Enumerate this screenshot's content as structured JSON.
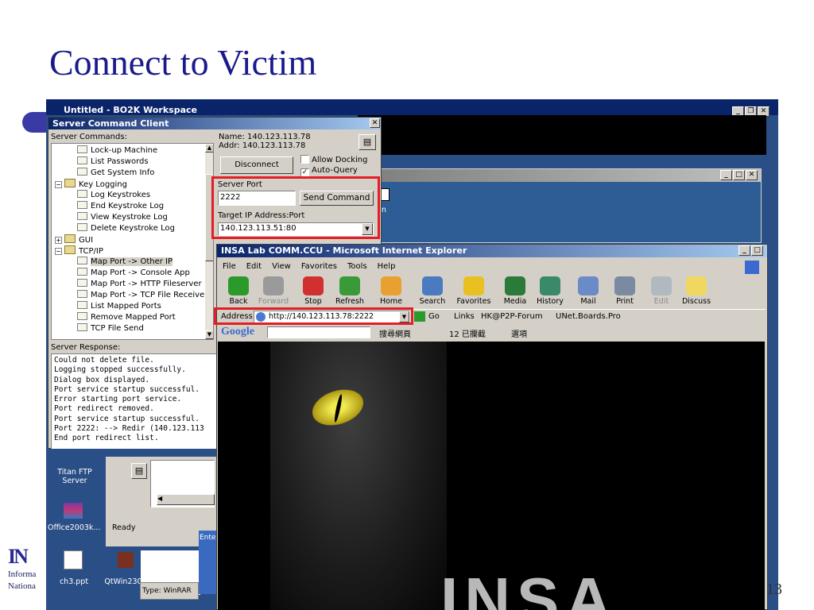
{
  "slide": {
    "title": "Connect to Victim",
    "page_number": "13"
  },
  "logo": {
    "line1": "Informa",
    "line2": "Nationa"
  },
  "bo2k": {
    "title": "Untitled - BO2K Workspace"
  },
  "server_client": {
    "title": "Server Command Client",
    "commands_label": "Server Commands:",
    "tree": [
      {
        "label": "Lock-up Machine",
        "level": 2
      },
      {
        "label": "List Passwords",
        "level": 2
      },
      {
        "label": "Get System Info",
        "level": 2
      },
      {
        "label": "Key Logging",
        "level": 1,
        "expander": "-"
      },
      {
        "label": "Log Keystrokes",
        "level": 2
      },
      {
        "label": "End Keystroke Log",
        "level": 2
      },
      {
        "label": "View Keystroke Log",
        "level": 2
      },
      {
        "label": "Delete Keystroke Log",
        "level": 2
      },
      {
        "label": "GUI",
        "level": 1,
        "expander": "+"
      },
      {
        "label": "TCP/IP",
        "level": 1,
        "expander": "-"
      },
      {
        "label": "Map Port -> Other IP",
        "level": 2,
        "selected": true
      },
      {
        "label": "Map Port -> Console App",
        "level": 2
      },
      {
        "label": "Map Port -> HTTP Fileserver",
        "level": 2
      },
      {
        "label": "Map Port -> TCP File Receive",
        "level": 2
      },
      {
        "label": "List Mapped Ports",
        "level": 2
      },
      {
        "label": "Remove Mapped Port",
        "level": 2
      },
      {
        "label": "TCP File Send",
        "level": 2
      }
    ],
    "name_line": "Name: 140.123.113.78",
    "addr_line": "Addr: 140.123.113.78",
    "disconnect_label": "Disconnect",
    "allow_docking_label": "Allow Docking",
    "auto_query_label": "Auto-Query",
    "allow_docking_checked": false,
    "auto_query_checked": true,
    "server_port_label": "Server Port",
    "server_port_value": "2222",
    "send_command_label": "Send Command",
    "target_label": "Target IP Address:Port",
    "target_value": "140.123.113.51:80",
    "response_label": "Server Response:",
    "response_text": "Could not delete file.\nLogging stopped successfully.\nDialog box displayed.\nPort service startup successful.\nError starting port service.\nPort redirect removed.\nPort service startup successful.\nPort 2222: --> Redir (140.123.113\nEnd port redirect list."
  },
  "ie": {
    "title": "INSA Lab COMM.CCU - Microsoft Internet Explorer",
    "menu": [
      "File",
      "Edit",
      "View",
      "Favorites",
      "Tools",
      "Help"
    ],
    "toolbar": [
      {
        "label": "Back",
        "icon": "back-arrow-icon",
        "color": "#2a9a2a"
      },
      {
        "label": "Forward",
        "icon": "forward-arrow-icon",
        "color": "#9a9a9a"
      },
      {
        "label": "Stop",
        "icon": "stop-icon",
        "color": "#d03030"
      },
      {
        "label": "Refresh",
        "icon": "refresh-icon",
        "color": "#3a9a3a"
      },
      {
        "label": "Home",
        "icon": "home-icon",
        "color": "#e8a030"
      },
      {
        "label": "Search",
        "icon": "search-icon",
        "color": "#4a7ac0"
      },
      {
        "label": "Favorites",
        "icon": "star-icon",
        "color": "#e8c020"
      },
      {
        "label": "Media",
        "icon": "media-icon",
        "color": "#2a7a3a"
      },
      {
        "label": "History",
        "icon": "history-icon",
        "color": "#3a8a6a"
      },
      {
        "label": "Mail",
        "icon": "mail-icon",
        "color": "#6a8ac8"
      },
      {
        "label": "Print",
        "icon": "print-icon",
        "color": "#7a8aa0"
      },
      {
        "label": "Edit",
        "icon": "edit-icon",
        "color": "#b0b8c0"
      },
      {
        "label": "Discuss",
        "icon": "discuss-icon",
        "color": "#f0d860"
      }
    ],
    "address_label": "Address",
    "address_value": "http://140.123.113.78:2222",
    "go_label": "Go",
    "links_label": "Links",
    "link1": "HK@P2P-Forum",
    "link2": "UNet.Boards.Pro",
    "google_label": "Google",
    "google_search": "搜尋網頁",
    "blocked": "12 已攔截",
    "options": "選項",
    "page_text": "INSA"
  },
  "desktop": {
    "titan": "Titan FTP\nServer",
    "office": "Office2003k...",
    "ch3": "ch3.ppt",
    "qtwin": "QtWin230",
    "ready": "Ready",
    "winrar_type": "Type: WinRAR",
    "enter": "Ente"
  },
  "colors": {
    "highlight": "#e31e24",
    "titlebar": "#0a246a",
    "slide_title": "#1a1a8c"
  }
}
